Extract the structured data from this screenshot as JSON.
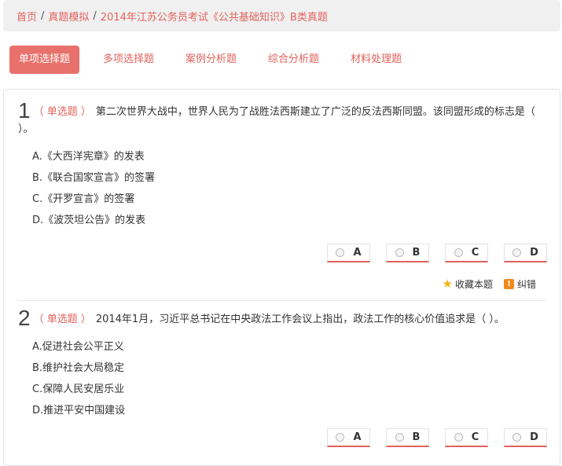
{
  "breadcrumb": {
    "home": "首页",
    "category": "真题模拟",
    "current": "2014年江苏公务员考试《公共基础知识》B类真题",
    "separator": "/"
  },
  "tabs": [
    {
      "label": "单项选择题",
      "active": true
    },
    {
      "label": "多项选择题",
      "active": false
    },
    {
      "label": "案例分析题",
      "active": false
    },
    {
      "label": "综合分析题",
      "active": false
    },
    {
      "label": "材料处理题",
      "active": false
    }
  ],
  "questions": [
    {
      "number": "1",
      "type": "（ 单选题 ）",
      "text": "第二次世界大战中，世界人民为了战胜法西斯建立了广泛的反法西斯同盟。该同盟形成的标志是（ ）。",
      "options": [
        "A.《大西洋宪章》的发表",
        "B.《联合国家宣言》的签署",
        "C.《开罗宣言》的签署",
        "D.《波茨坦公告》的发表"
      ],
      "answers": [
        "A",
        "B",
        "C",
        "D"
      ],
      "favorite_label": "收藏本题",
      "report_label": "纠错",
      "report_icon_text": "!"
    },
    {
      "number": "2",
      "type": "（ 单选题 ）",
      "text": "2014年1月，习近平总书记在中央政法工作会议上指出，政法工作的核心价值追求是（ ）。",
      "options": [
        "A.促进社会公平正义",
        "B.维护社会大局稳定",
        "C.保障人民安居乐业",
        "D.推进平安中国建设"
      ],
      "answers": [
        "A",
        "B",
        "C",
        "D"
      ]
    }
  ],
  "colors": {
    "accent": "#e8716c",
    "link": "#e0625c",
    "star": "#f3b21a",
    "report": "#f08a1c"
  },
  "icons": {
    "favorite": "star-icon",
    "report": "exclamation-icon",
    "answer": "radio-icon"
  }
}
